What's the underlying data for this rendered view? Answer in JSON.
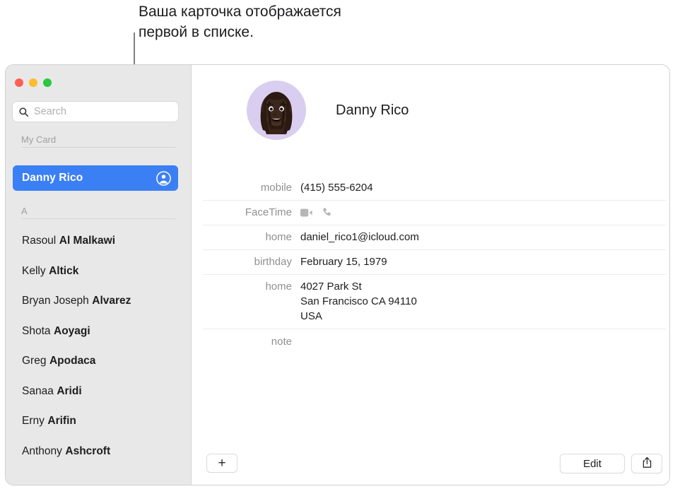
{
  "callout": {
    "text": "Ваша карточка отображается\nпервой в списке."
  },
  "window": {
    "traffic_lights": [
      {
        "name": "close",
        "color": "#ff5f57"
      },
      {
        "name": "minimize",
        "color": "#febc2e"
      },
      {
        "name": "zoom",
        "color": "#28c840"
      }
    ]
  },
  "sidebar": {
    "search": {
      "placeholder": "Search",
      "value": "",
      "icon": "search-icon"
    },
    "sections": {
      "my_card": "My Card",
      "alpha": "A"
    },
    "selected": {
      "name": "Danny Rico",
      "badge_icon": "person-circle-icon",
      "accent_color": "#3b7ff5"
    },
    "contacts": [
      {
        "first": "Rasoul",
        "last": "Al Malkawi"
      },
      {
        "first": "Kelly",
        "last": "Altick"
      },
      {
        "first": "Bryan Joseph",
        "last": "Alvarez"
      },
      {
        "first": "Shota",
        "last": "Aoyagi"
      },
      {
        "first": "Greg",
        "last": "Apodaca"
      },
      {
        "first": "Sanaa",
        "last": "Aridi"
      },
      {
        "first": "Erny",
        "last": "Arifin"
      },
      {
        "first": "Anthony",
        "last": "Ashcroft"
      }
    ]
  },
  "detail": {
    "name": "Danny Rico",
    "avatar_bg": "#d9cdf0",
    "fields": [
      {
        "label": "mobile",
        "value": "(415) 555-6204",
        "type": "text"
      },
      {
        "label": "FaceTime",
        "value": "",
        "type": "icons",
        "icons": [
          "video-camera-icon",
          "phone-icon"
        ]
      },
      {
        "label": "home",
        "value": "daniel_rico1@icloud.com",
        "type": "text"
      },
      {
        "label": "birthday",
        "value": "February 15, 1979",
        "type": "text"
      },
      {
        "label": "home",
        "value": "4027 Park St\nSan Francisco CA 94110\nUSA",
        "type": "text"
      },
      {
        "label": "note",
        "value": "",
        "type": "text"
      }
    ]
  },
  "toolbar": {
    "add_label": "+",
    "edit_label": "Edit",
    "share_icon": "share-icon"
  }
}
